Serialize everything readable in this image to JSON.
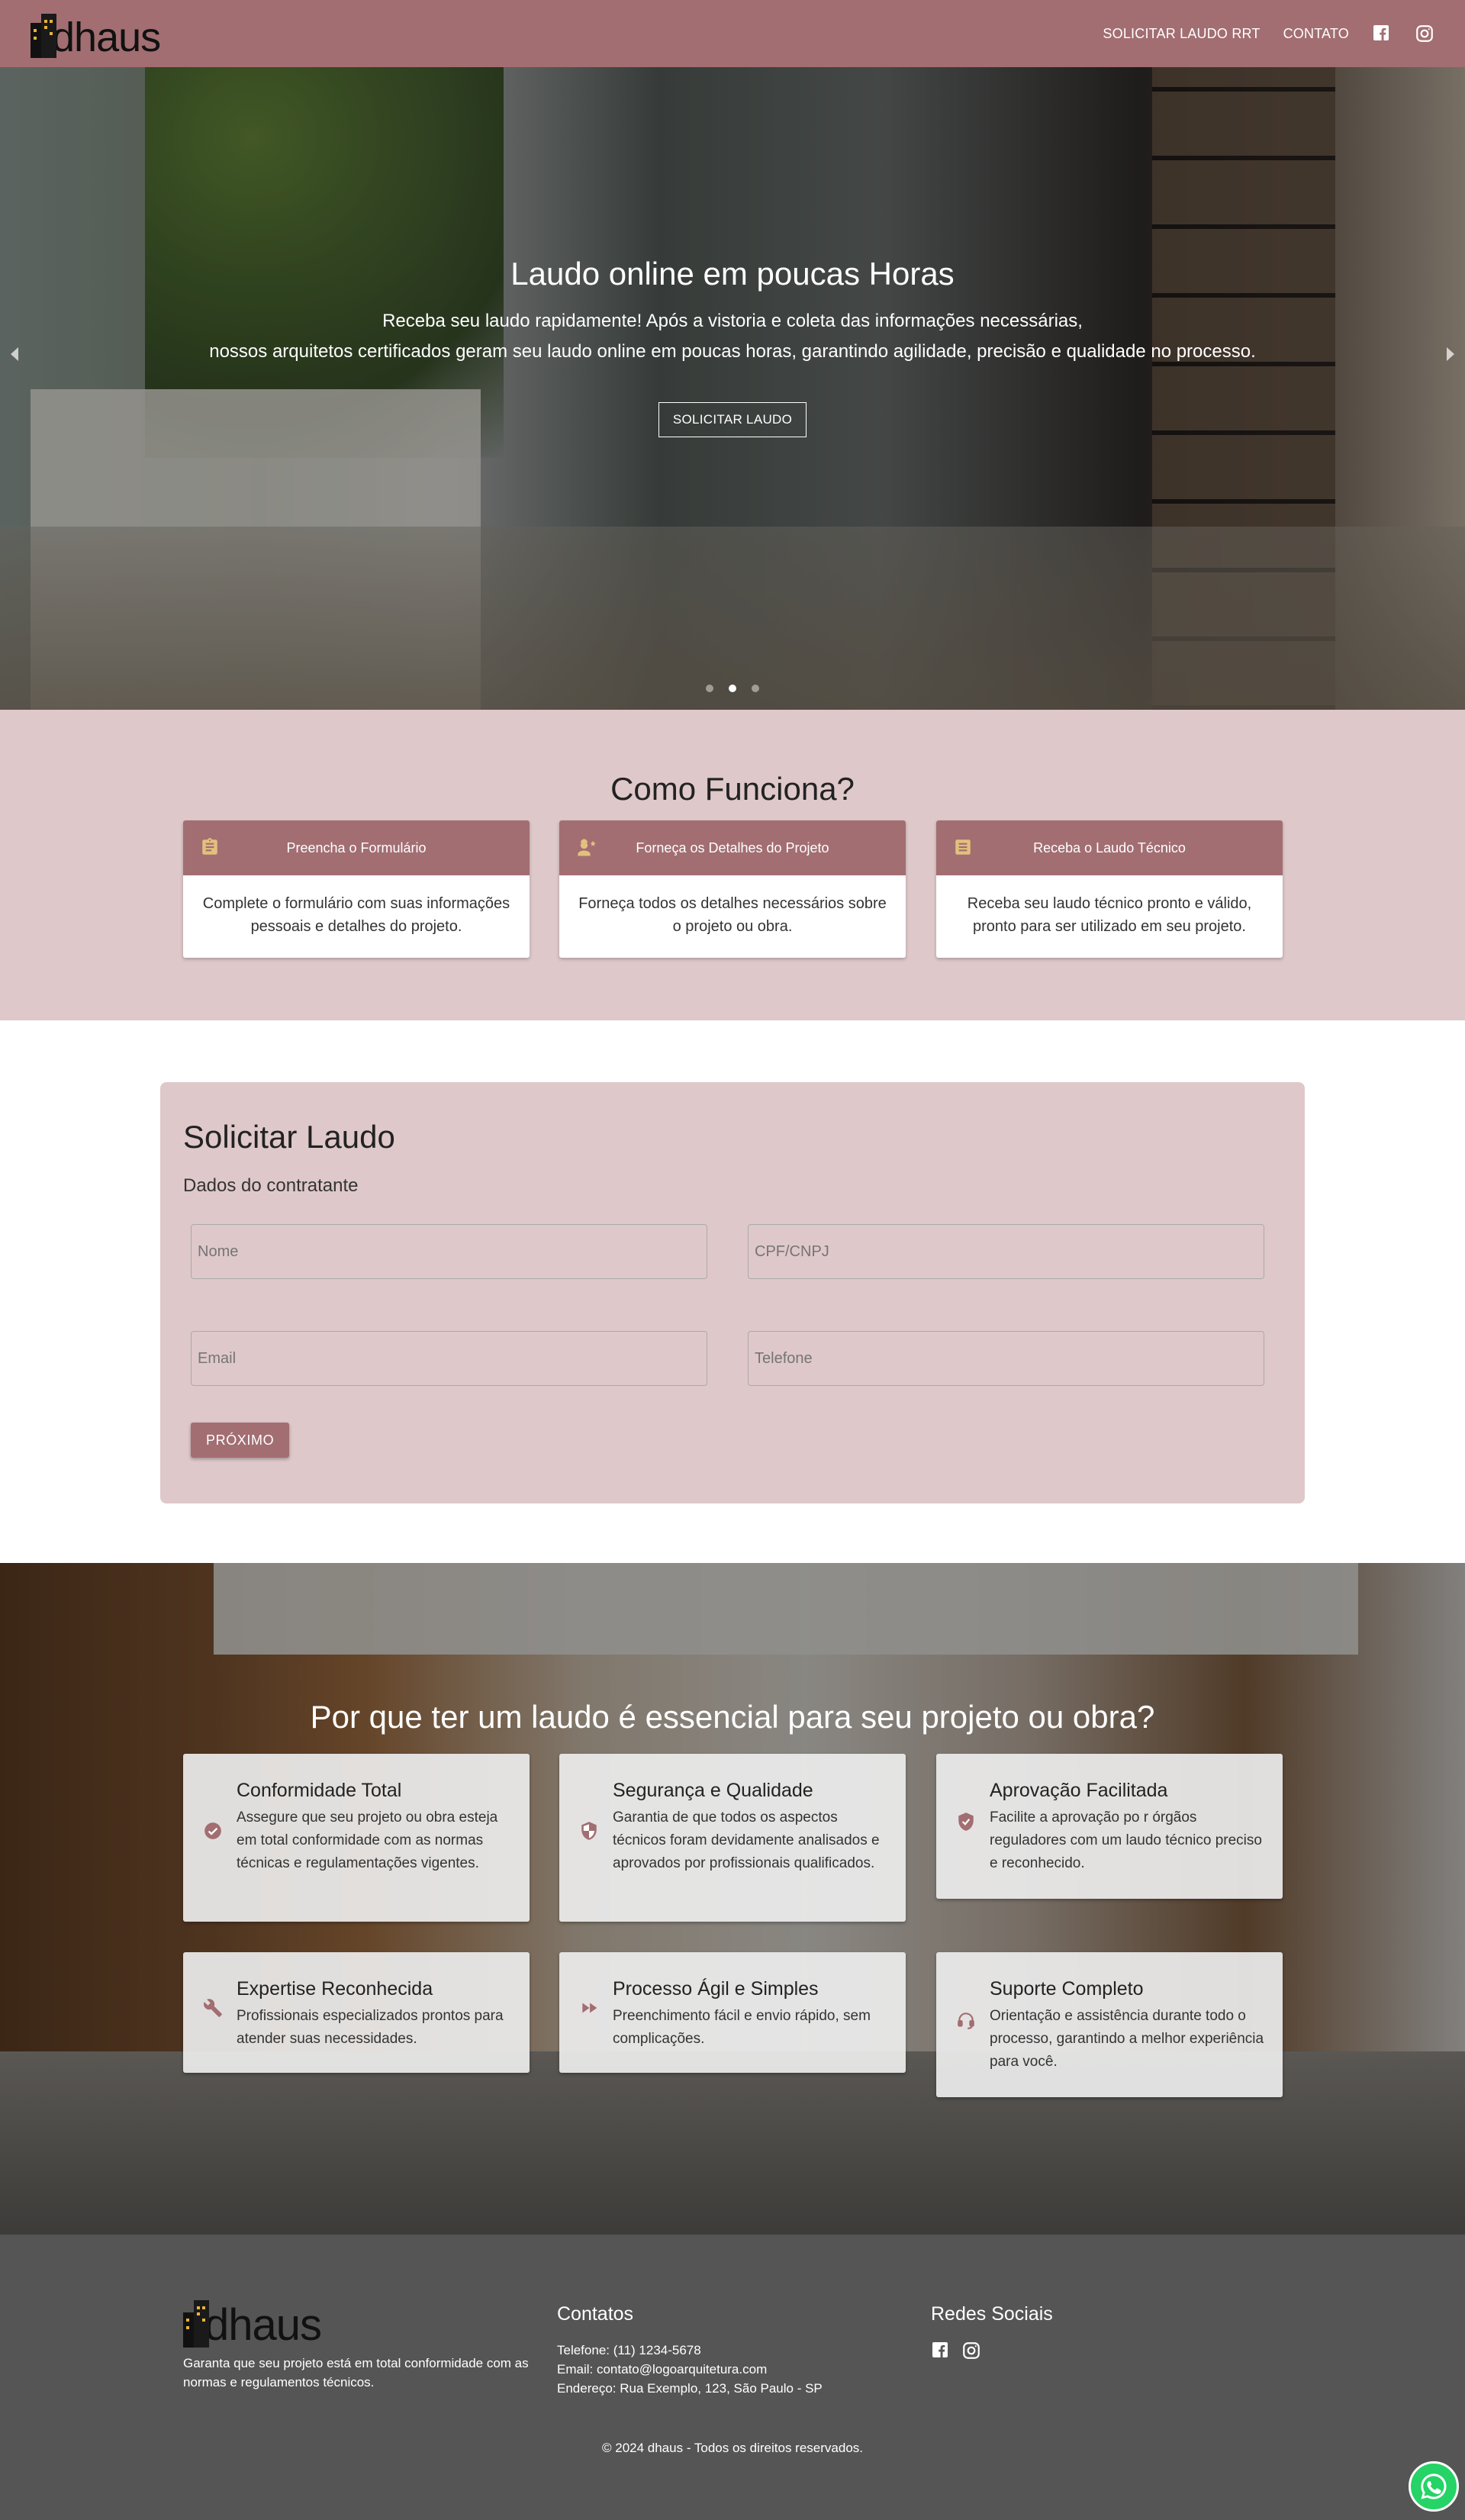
{
  "brand": {
    "name": "dhaus"
  },
  "nav": {
    "items": [
      "SOLICITAR LAUDO RRT",
      "CONTATO"
    ],
    "facebook_icon": "facebook-icon",
    "instagram_icon": "instagram-icon"
  },
  "hero": {
    "title": "Laudo online em poucas Horas",
    "subtitle_line1": "Receba seu laudo rapidamente! Após a vistoria e coleta das informações necessárias,",
    "subtitle_line2": "nossos arquitetos certificados geram seu laudo online em poucas horas, garantindo agilidade, precisão e qualidade no processo.",
    "button": "SOLICITAR LAUDO",
    "slides": 3,
    "active_slide": 2
  },
  "how": {
    "title": "Como Funciona?",
    "steps": [
      {
        "title": "Preencha o Formulário",
        "text": "Complete o formulário com suas informações pessoais e detalhes do projeto.",
        "icon": "clipboard-icon"
      },
      {
        "title": "Forneça os Detalhes do Projeto",
        "text": "Forneça todos os detalhes necessários sobre o projeto ou obra.",
        "icon": "engineer-icon"
      },
      {
        "title": "Receba o Laudo Técnico",
        "text": "Receba seu laudo técnico pronto e válido, pronto para ser utilizado em seu projeto.",
        "icon": "document-icon"
      }
    ]
  },
  "form": {
    "title": "Solicitar Laudo",
    "subtitle": "Dados do contratante",
    "fields": {
      "nome": "Nome",
      "cpf": "CPF/CNPJ",
      "email": "Email",
      "telefone": "Telefone"
    },
    "next_button": "PRÓXIMO"
  },
  "why": {
    "title": "Por que ter um laudo é essencial para seu projeto ou obra?",
    "cards": [
      {
        "title": "Conformidade Total",
        "text": "Assegure que seu projeto ou obra esteja em total conformidade com as normas técnicas e regulamentações vigentes.",
        "icon": "check-circle-icon"
      },
      {
        "title": "Segurança e Qualidade",
        "text": "Garantia de que todos os aspectos técnicos foram devidamente analisados e aprovados por profissionais qualificados.",
        "icon": "shield-icon"
      },
      {
        "title": "Aprovação Facilitada",
        "text": "Facilite a aprovação po r órgãos reguladores com um laudo técnico preciso e reconhecido.",
        "icon": "verified-shield-icon"
      },
      {
        "title": "Expertise Reconhecida",
        "text": "Profissionais especializados prontos para atender suas necessidades.",
        "icon": "wrench-icon"
      },
      {
        "title": "Processo Ágil e Simples",
        "text": "Preenchimento fácil e envio rápido, sem complicações.",
        "icon": "fast-forward-icon"
      },
      {
        "title": "Suporte Completo",
        "text": "Orientação e assistência durante todo o processo, garantindo a melhor experiência para você.",
        "icon": "headset-icon"
      }
    ]
  },
  "footer": {
    "description": "Garanta que seu projeto está em total conformidade com as normas e regulamentos técnicos.",
    "contacts_title": "Contatos",
    "phone": "Telefone: (11) 1234-5678",
    "email": "Email: contato@logoarquitetura.com",
    "address": "Endereço: Rua Exemplo, 123, São Paulo - SP",
    "social_title": "Redes Sociais",
    "copyright": "© 2024 dhaus - Todos os direitos reservados."
  },
  "colors": {
    "primary": "#a26e72",
    "section_bg": "#dfc8ca",
    "footer_bg": "#555555",
    "icon_accent": "#e3c07d",
    "whatsapp": "#25d366"
  }
}
